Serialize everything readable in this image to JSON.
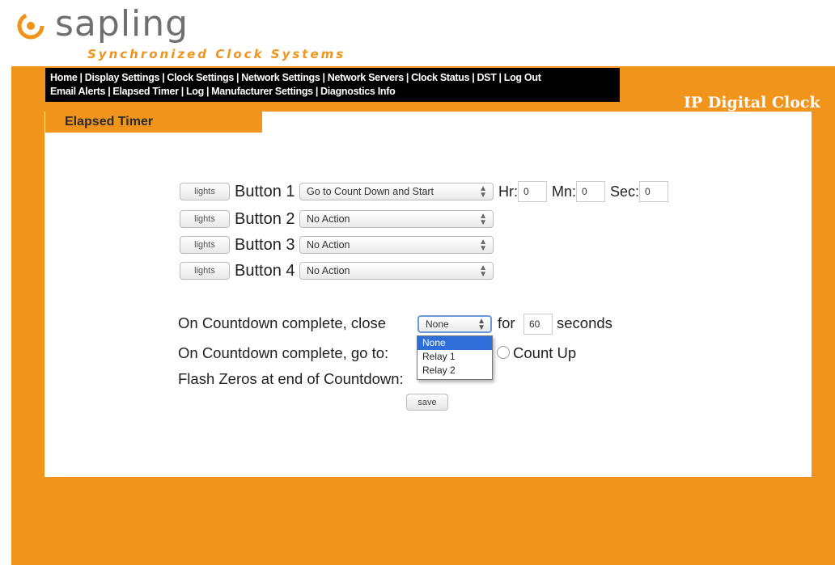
{
  "brand": {
    "name": "sapling",
    "tagline": "Synchronized Clock Systems",
    "accent": "#f0941c"
  },
  "nav": {
    "row1": [
      "Home",
      "Display Settings",
      "Clock Settings",
      "Network Settings",
      "Network Servers",
      "Clock Status",
      "DST",
      "Log Out"
    ],
    "row2": [
      "Email Alerts",
      "Elapsed Timer",
      "Log",
      "Manufacturer Settings",
      "Diagnostics Info"
    ]
  },
  "product_title": "IP Digital Clock",
  "tab_title": "Elapsed Timer",
  "buttons": [
    {
      "lights_label": "lights",
      "label": "Button 1",
      "action": "Go to Count Down and Start"
    },
    {
      "lights_label": "lights",
      "label": "Button 2",
      "action": "No Action"
    },
    {
      "lights_label": "lights",
      "label": "Button 3",
      "action": "No Action"
    },
    {
      "lights_label": "lights",
      "label": "Button 4",
      "action": "No Action"
    }
  ],
  "time": {
    "hr_label": "Hr:",
    "hr_value": "0",
    "mn_label": "Mn:",
    "mn_value": "0",
    "sec_label": "Sec:",
    "sec_value": "0"
  },
  "countdown": {
    "close_label": "On Countdown complete, close",
    "close_value": "None",
    "for_label": "for",
    "seconds_value": "60",
    "seconds_label": "seconds",
    "goto_label": "On Countdown complete, go to:",
    "count_up_label": "Count Up",
    "flash_label": "Flash Zeros at end of Countdown:",
    "dropdown_options": [
      "None",
      "Relay 1",
      "Relay 2"
    ],
    "dropdown_selected_index": 0
  },
  "save_label": "save",
  "icons": {
    "logo": "sapling-logo-icon",
    "select_arrow": "updown-arrow-icon"
  }
}
